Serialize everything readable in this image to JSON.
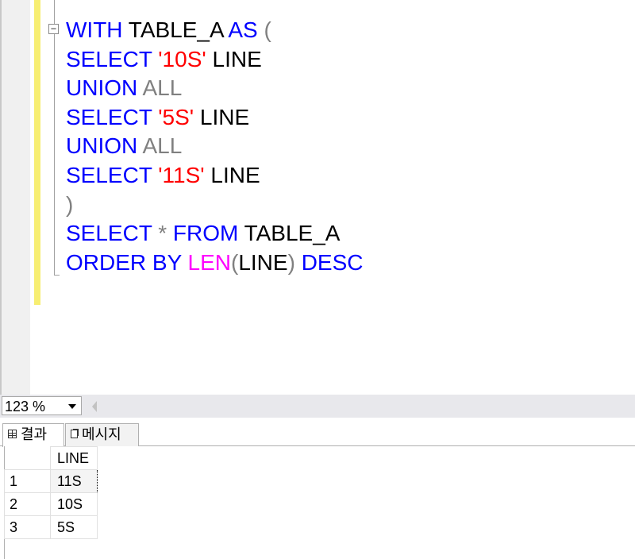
{
  "editor": {
    "lines": [
      [
        {
          "t": "WITH",
          "c": "kw"
        },
        {
          "t": " TABLE_A ",
          "c": "id"
        },
        {
          "t": "AS",
          "c": "kw"
        },
        {
          "t": " (",
          "c": "op"
        }
      ],
      [
        {
          "t": "SELECT",
          "c": "kw"
        },
        {
          "t": " ",
          "c": "id"
        },
        {
          "t": "'10S'",
          "c": "str"
        },
        {
          "t": " LINE",
          "c": "id"
        }
      ],
      [
        {
          "t": "UNION",
          "c": "kw"
        },
        {
          "t": " ALL",
          "c": "op"
        }
      ],
      [
        {
          "t": "SELECT",
          "c": "kw"
        },
        {
          "t": " ",
          "c": "id"
        },
        {
          "t": "'5S'",
          "c": "str"
        },
        {
          "t": " LINE",
          "c": "id"
        }
      ],
      [
        {
          "t": "UNION",
          "c": "kw"
        },
        {
          "t": " ALL",
          "c": "op"
        }
      ],
      [
        {
          "t": "SELECT",
          "c": "kw"
        },
        {
          "t": " ",
          "c": "id"
        },
        {
          "t": "'11S'",
          "c": "str"
        },
        {
          "t": " LINE",
          "c": "id"
        }
      ],
      [
        {
          "t": ")",
          "c": "op"
        }
      ],
      [
        {
          "t": "SELECT",
          "c": "kw"
        },
        {
          "t": " * ",
          "c": "op"
        },
        {
          "t": "FROM",
          "c": "kw"
        },
        {
          "t": " TABLE_A",
          "c": "id"
        }
      ],
      [
        {
          "t": "ORDER BY",
          "c": "kw"
        },
        {
          "t": " ",
          "c": "id"
        },
        {
          "t": "LEN",
          "c": "fn"
        },
        {
          "t": "(",
          "c": "op"
        },
        {
          "t": "LINE",
          "c": "id"
        },
        {
          "t": ")",
          "c": "op"
        },
        {
          "t": " ",
          "c": "id"
        },
        {
          "t": "DESC",
          "c": "kw"
        }
      ]
    ],
    "fold_symbol": "−"
  },
  "zoom": {
    "value": "123 %"
  },
  "tabs": [
    {
      "label": "결과",
      "icon": "grid-icon"
    },
    {
      "label": "메시지",
      "icon": "message-icon"
    }
  ],
  "results": {
    "columns": [
      "LINE"
    ],
    "rows": [
      {
        "num": "1",
        "cells": [
          "11S"
        ]
      },
      {
        "num": "2",
        "cells": [
          "10S"
        ]
      },
      {
        "num": "3",
        "cells": [
          "5S"
        ]
      }
    ]
  },
  "colors": {
    "keyword": "#0000ff",
    "string": "#ff0000",
    "operator": "#808080",
    "function": "#ff00ff",
    "change_bar": "#f7ee72"
  }
}
